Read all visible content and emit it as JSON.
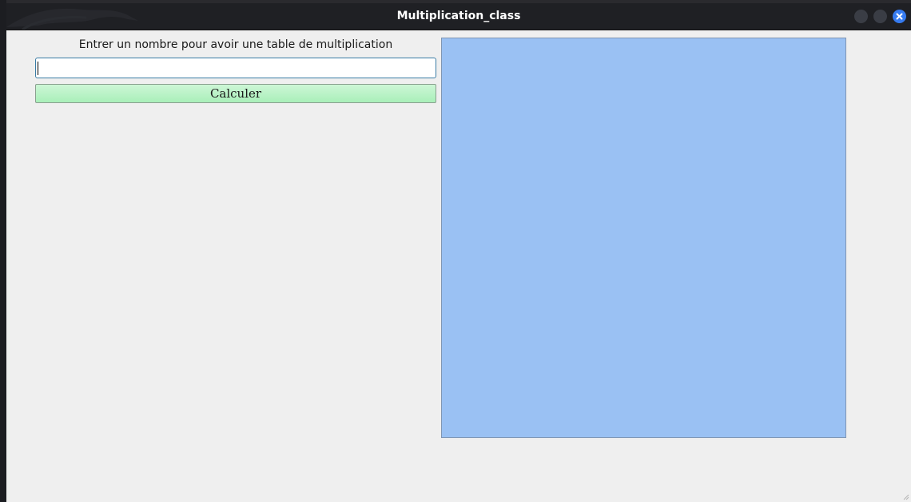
{
  "window": {
    "title": "Multiplication_class"
  },
  "form": {
    "prompt": "Entrer un nombre pour avoir une table de multiplication",
    "input_value": "",
    "button_label": "Calculer"
  },
  "result_panel": {
    "color": "#9ac1f3"
  },
  "icons": {
    "titlebar_decoration": "kali-dragon-icon",
    "minimize": "minimize-icon",
    "maximize": "maximize-icon",
    "close": "close-icon"
  },
  "colors": {
    "titlebar": "#1f2024",
    "close_button": "#367bf0",
    "button_green": "#b9f3c6",
    "window_bg": "#efefef"
  }
}
